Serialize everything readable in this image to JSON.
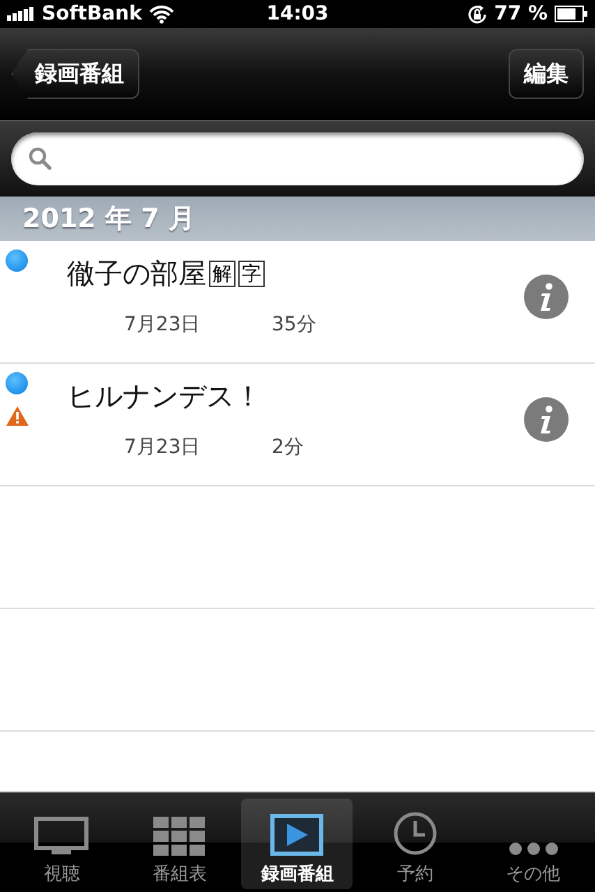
{
  "status_bar": {
    "carrier": "SoftBank",
    "time": "14:03",
    "battery": "77 %"
  },
  "nav_bar": {
    "back_button": "録画番組",
    "edit_button": "編集"
  },
  "section": {
    "title": "2012 年 7 月"
  },
  "recordings": [
    {
      "title": "徹子の部屋",
      "badges": [
        "解",
        "字"
      ],
      "date": "7月23日",
      "duration": "35分",
      "unwatched": true,
      "warning": false
    },
    {
      "title": "ヒルナンデス！",
      "date": "7月23日",
      "duration": "2分",
      "unwatched": true,
      "warning": true
    }
  ],
  "tab_bar": [
    {
      "label": "視聴",
      "kind": "tv",
      "selected": false
    },
    {
      "label": "番組表",
      "kind": "grid",
      "selected": false
    },
    {
      "label": "録画番組",
      "kind": "play",
      "selected": true
    },
    {
      "label": "予約",
      "kind": "clock",
      "selected": false
    },
    {
      "label": "その他",
      "kind": "dots",
      "selected": false
    }
  ]
}
